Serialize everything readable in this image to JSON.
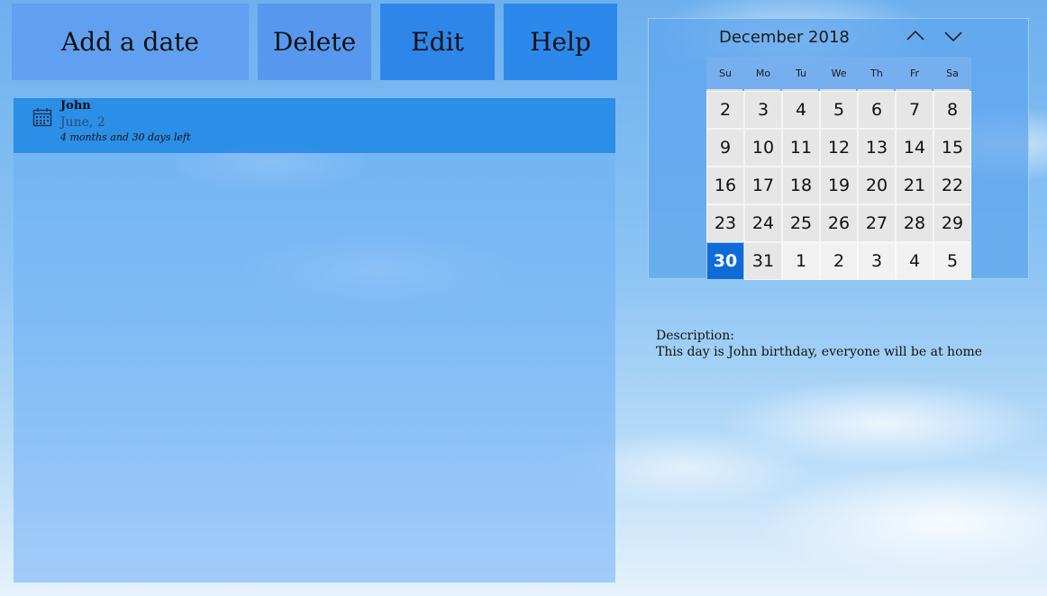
{
  "toolbar": {
    "add_label": "Add a date",
    "delete_label": "Delete",
    "edit_label": "Edit",
    "help_label": "Help"
  },
  "list": {
    "items": [
      {
        "name": "John",
        "date": "June, 2",
        "remaining": "4 months and 30 days left",
        "icon": "calendar-icon"
      }
    ]
  },
  "calendar": {
    "title": "December 2018",
    "weekdays": [
      "Su",
      "Mo",
      "Tu",
      "We",
      "Th",
      "Fr",
      "Sa"
    ],
    "weeks": [
      [
        "2",
        "3",
        "4",
        "5",
        "6",
        "7",
        "8"
      ],
      [
        "9",
        "10",
        "11",
        "12",
        "13",
        "14",
        "15"
      ],
      [
        "16",
        "17",
        "18",
        "19",
        "20",
        "21",
        "22"
      ],
      [
        "23",
        "24",
        "25",
        "26",
        "27",
        "28",
        "29"
      ],
      [
        "30",
        "31",
        "1",
        "2",
        "3",
        "4",
        "5"
      ]
    ],
    "today": "30",
    "accent": "#0f6cd6"
  },
  "description": {
    "label": "Description:",
    "text": "This day is John birthday, everyone will be at home"
  }
}
